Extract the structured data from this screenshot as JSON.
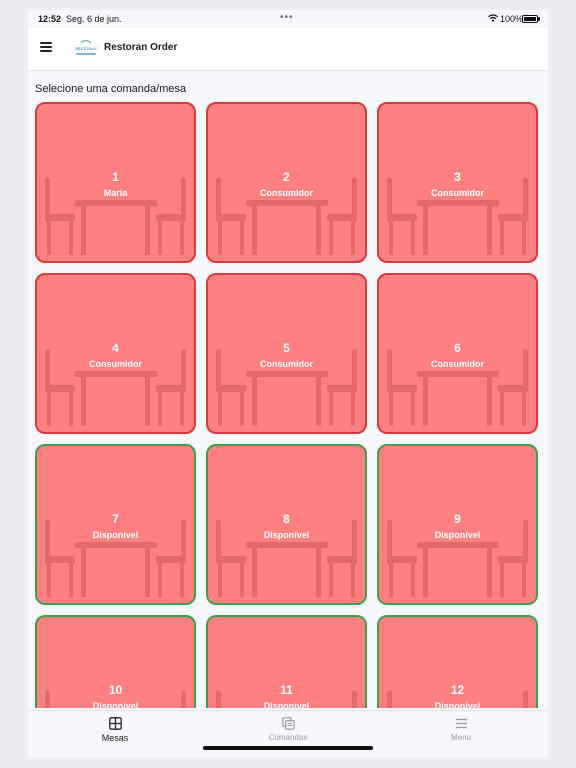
{
  "status_bar": {
    "time": "12:52",
    "date": "Seg. 6 de jun.",
    "dots": "•••",
    "battery": "100%"
  },
  "app_bar": {
    "title": "Restoran Order",
    "logo_text": "RESTORAN"
  },
  "main": {
    "section_title": "Selecione uma comanda/mesa",
    "colors": {
      "tile_fill": "#ff8080",
      "occupied_border": "#d63a3a",
      "free_border": "#3f9e4a",
      "furniture": "#e46a6a"
    },
    "tables": [
      {
        "number": "1",
        "status": "Maria",
        "state": "occupied"
      },
      {
        "number": "2",
        "status": "Consumidor",
        "state": "occupied"
      },
      {
        "number": "3",
        "status": "Consumidor",
        "state": "occupied"
      },
      {
        "number": "4",
        "status": "Consumidor",
        "state": "occupied"
      },
      {
        "number": "5",
        "status": "Consumidor",
        "state": "occupied"
      },
      {
        "number": "6",
        "status": "Consumidor",
        "state": "occupied"
      },
      {
        "number": "7",
        "status": "Disponível",
        "state": "free"
      },
      {
        "number": "8",
        "status": "Disponível",
        "state": "free"
      },
      {
        "number": "9",
        "status": "Disponível",
        "state": "free"
      },
      {
        "number": "10",
        "status": "Disponível",
        "state": "free"
      },
      {
        "number": "11",
        "status": "Disponível",
        "state": "free"
      },
      {
        "number": "12",
        "status": "Disponível",
        "state": "free"
      }
    ]
  },
  "tab_bar": {
    "tabs": [
      {
        "label": "Mesas",
        "icon": "grid-icon",
        "active": true
      },
      {
        "label": "Comandas",
        "icon": "copy-icon",
        "active": false
      },
      {
        "label": "Menu",
        "icon": "menu-icon",
        "active": false
      }
    ]
  }
}
